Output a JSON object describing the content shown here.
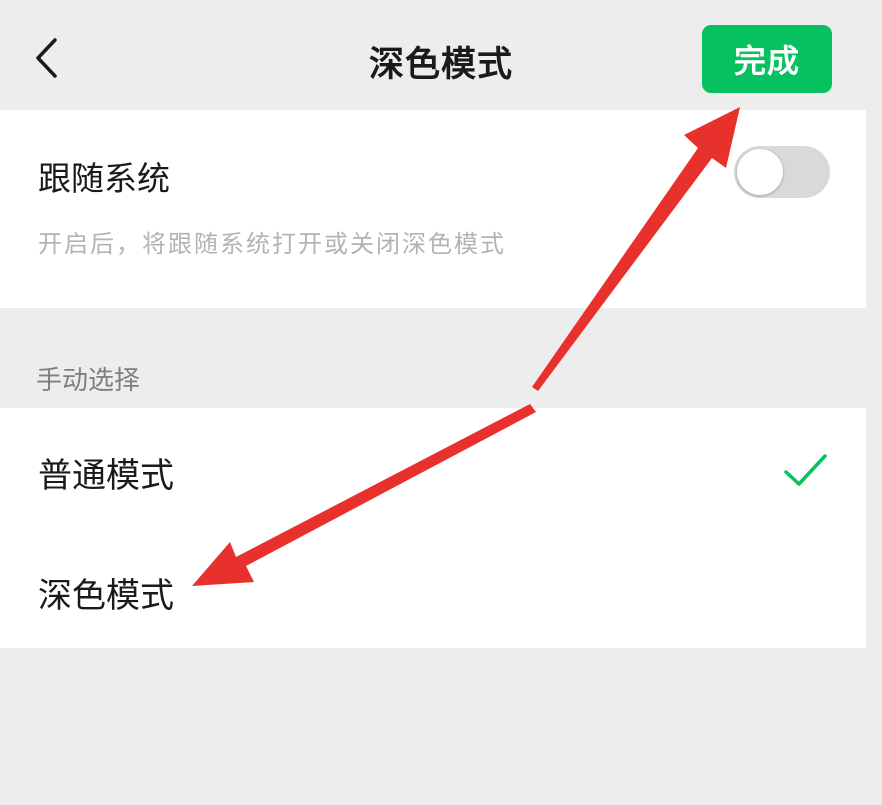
{
  "nav": {
    "back_icon": "chevron-left-icon",
    "title": "深色模式",
    "done_label": "完成"
  },
  "follow_system": {
    "label": "跟随系统",
    "description": "开启后，将跟随系统打开或关闭深色模式",
    "enabled": false
  },
  "manual": {
    "section_label": "手动选择",
    "options": [
      {
        "label": "普通模式",
        "selected": true
      },
      {
        "label": "深色模式",
        "selected": false
      }
    ]
  },
  "colors": {
    "accent": "#07c160",
    "annotation_arrow": "#e8302c",
    "background": "#ededed"
  }
}
